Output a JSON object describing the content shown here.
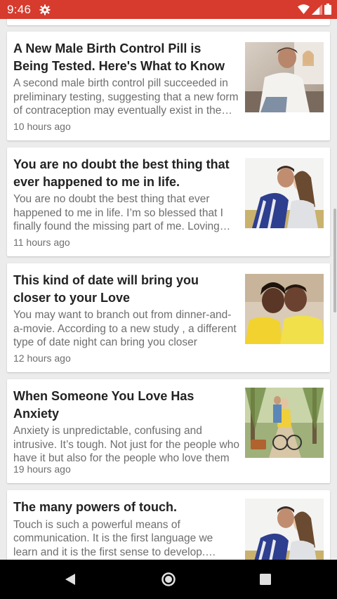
{
  "status_bar": {
    "time": "9:46",
    "icons": [
      "settings-gear-icon",
      "wifi-icon",
      "cellular-signal-icon",
      "battery-icon"
    ]
  },
  "articles": [
    {
      "title": "A New Male Birth Control Pill is Being Tested. Here's What to Know",
      "summary": "A second male birth control pill succeeded in preliminary testing, suggesting that a new form of contraception may eventually exist in the future",
      "time": "10 hours ago"
    },
    {
      "title": "You are no doubt the best thing that ever happened to me in life.",
      "summary": "You are no doubt the best thing that ever happened to me in life. I’m so blessed that I finally found the missing part of me. Loving you is my purpose",
      "time": "11 hours ago"
    },
    {
      "title": "This kind of date will bring you closer to your Love",
      "summary": "You may want to branch out from dinner-and-a-movie. According to a new study , a different type of date night can bring you closer",
      "time": "12 hours ago"
    },
    {
      "title": "When Someone You Love Has Anxiety",
      "summary": "Anxiety is unpredictable, confusing and intrusive. It’s tough. Not just for the people who have it but also for the people who love them",
      "time": "19 hours ago"
    },
    {
      "title": "The many powers of touch.",
      "summary": "Touch is such a powerful means of communication. It is the first language we learn and it is the first sense to develop. Developing",
      "time": ""
    }
  ],
  "nav_bar": {
    "buttons": [
      "back-icon",
      "home-icon",
      "recents-icon"
    ]
  },
  "colors": {
    "status_bar": "#d63b2e",
    "background": "#ececec",
    "card": "#ffffff",
    "title_text": "#222222",
    "secondary_text": "#6e6e6e",
    "nav_bar": "#000000"
  }
}
